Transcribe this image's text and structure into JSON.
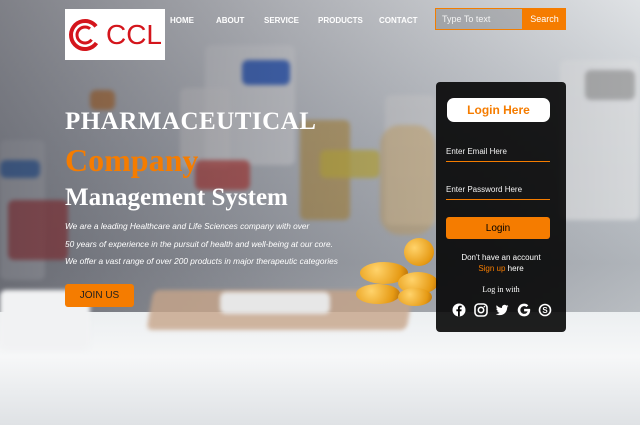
{
  "brand": {
    "logo_text": "CCL",
    "logo_color": "#d4151c"
  },
  "nav": {
    "items": [
      "HOME",
      "ABOUT",
      "SERVICE",
      "PRODUCTS",
      "CONTACT"
    ]
  },
  "search": {
    "placeholder": "Type To text",
    "button_label": "Search"
  },
  "hero": {
    "line1": "PHARMACEUTICAL",
    "line2": "Company",
    "line3": "Management System",
    "desc1": "We are a leading Healthcare and Life Sciences company with over",
    "desc2": "50 years of experience in the pursuit of health and well-being at our core.",
    "desc3": "We offer a vast range of over 200 products in major therapeutic categories",
    "join_label": "JOIN US"
  },
  "login": {
    "title": "Login Here",
    "email_placeholder": "Enter Email Here",
    "password_placeholder": "Enter Password Here",
    "button_label": "Login",
    "no_account": "Don't have an account",
    "signup_link": "Sign up",
    "signup_suffix": " here",
    "login_with": "Log in with",
    "socials": [
      "facebook-icon",
      "instagram-icon",
      "twitter-icon",
      "google-icon",
      "skype-icon"
    ]
  },
  "colors": {
    "accent": "#f57c00",
    "panel": "#000000"
  }
}
